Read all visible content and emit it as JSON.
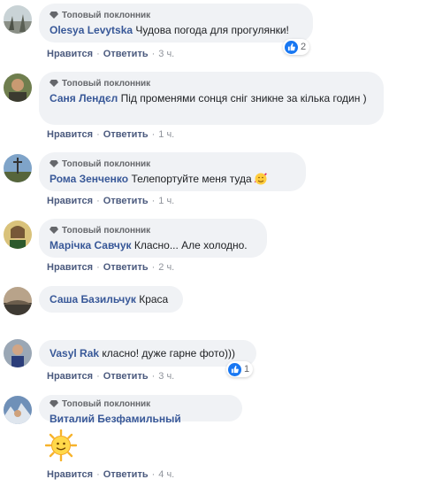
{
  "badge_label": "Топовый поклонник",
  "action_like": "Нравится",
  "action_reply": "Ответить",
  "separator": "·",
  "comments": [
    {
      "author": "Olesya Levytska",
      "text": "Чудова погода для прогулянки!",
      "time": "3 ч.",
      "reactions": "2"
    },
    {
      "author": "Саня Лендєл",
      "text": "Під променями сонця сніг зникне за кілька годин )",
      "time": "1 ч."
    },
    {
      "author": "Рома Зенченко",
      "text": "Телепортуйте меня туда",
      "time": "1 ч."
    },
    {
      "author": "Марічка Савчук",
      "text": "Класно... Але холодно.",
      "time": "2 ч."
    },
    {
      "author": "Саша Базильчук",
      "text": "Краса"
    },
    {
      "author": "Vasyl Rak",
      "text": "класно! дуже гарне фото)))",
      "time": "3 ч.",
      "reactions": "1"
    },
    {
      "author": "Виталий Безфамильный",
      "text": "",
      "time": "4 ч."
    }
  ],
  "colors": {
    "author": "#385898",
    "bubble": "#f0f2f5",
    "like": "#1877f2"
  }
}
